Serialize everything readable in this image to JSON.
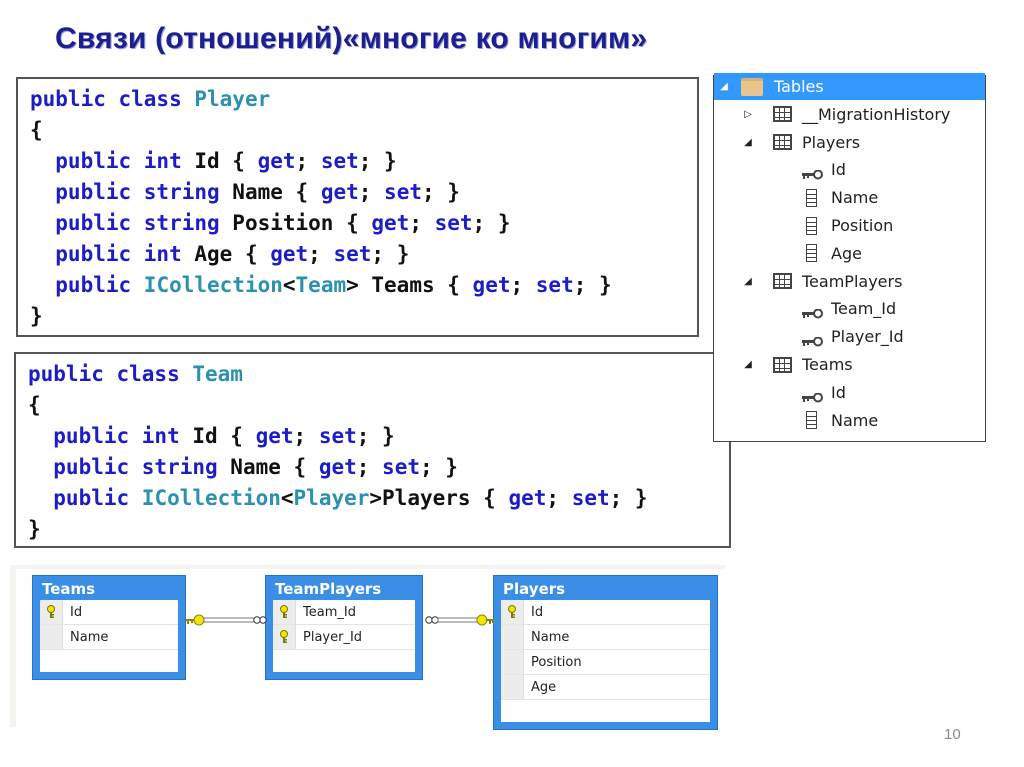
{
  "slide": {
    "title": "Связи (отношений)«многие ко многим»",
    "page_number": "10"
  },
  "code": {
    "player": {
      "lines": [
        [
          {
            "t": "public class ",
            "c": "kw"
          },
          {
            "t": "Player",
            "c": "ty"
          }
        ],
        [
          {
            "t": "{",
            "c": "pl"
          }
        ],
        [
          {
            "t": "  public int ",
            "c": "kw"
          },
          {
            "t": "Id { ",
            "c": "pl"
          },
          {
            "t": "get",
            "c": "kw"
          },
          {
            "t": "; ",
            "c": "pl"
          },
          {
            "t": "set",
            "c": "kw"
          },
          {
            "t": "; }",
            "c": "pl"
          }
        ],
        [
          {
            "t": "  public string ",
            "c": "kw"
          },
          {
            "t": "Name { ",
            "c": "pl"
          },
          {
            "t": "get",
            "c": "kw"
          },
          {
            "t": "; ",
            "c": "pl"
          },
          {
            "t": "set",
            "c": "kw"
          },
          {
            "t": "; }",
            "c": "pl"
          }
        ],
        [
          {
            "t": "  public string ",
            "c": "kw"
          },
          {
            "t": "Position { ",
            "c": "pl"
          },
          {
            "t": "get",
            "c": "kw"
          },
          {
            "t": "; ",
            "c": "pl"
          },
          {
            "t": "set",
            "c": "kw"
          },
          {
            "t": "; }",
            "c": "pl"
          }
        ],
        [
          {
            "t": "  public int ",
            "c": "kw"
          },
          {
            "t": "Age { ",
            "c": "pl"
          },
          {
            "t": "get",
            "c": "kw"
          },
          {
            "t": "; ",
            "c": "pl"
          },
          {
            "t": "set",
            "c": "kw"
          },
          {
            "t": "; }",
            "c": "pl"
          }
        ],
        [
          {
            "t": "  public ",
            "c": "kw"
          },
          {
            "t": "ICollection",
            "c": "ty"
          },
          {
            "t": "<",
            "c": "pl"
          },
          {
            "t": "Team",
            "c": "ty"
          },
          {
            "t": "> Teams { ",
            "c": "pl"
          },
          {
            "t": "get",
            "c": "kw"
          },
          {
            "t": "; ",
            "c": "pl"
          },
          {
            "t": "set",
            "c": "kw"
          },
          {
            "t": "; }",
            "c": "pl"
          }
        ],
        [
          {
            "t": "}",
            "c": "pl"
          }
        ]
      ]
    },
    "team": {
      "lines": [
        [
          {
            "t": "public class ",
            "c": "kw"
          },
          {
            "t": "Team",
            "c": "ty"
          }
        ],
        [
          {
            "t": "{",
            "c": "pl"
          }
        ],
        [
          {
            "t": "  public int ",
            "c": "kw"
          },
          {
            "t": "Id { ",
            "c": "pl"
          },
          {
            "t": "get",
            "c": "kw"
          },
          {
            "t": "; ",
            "c": "pl"
          },
          {
            "t": "set",
            "c": "kw"
          },
          {
            "t": "; }",
            "c": "pl"
          }
        ],
        [
          {
            "t": "  public string ",
            "c": "kw"
          },
          {
            "t": "Name { ",
            "c": "pl"
          },
          {
            "t": "get",
            "c": "kw"
          },
          {
            "t": "; ",
            "c": "pl"
          },
          {
            "t": "set",
            "c": "kw"
          },
          {
            "t": "; }",
            "c": "pl"
          }
        ],
        [
          {
            "t": "  public ",
            "c": "kw"
          },
          {
            "t": "ICollection",
            "c": "ty"
          },
          {
            "t": "<",
            "c": "pl"
          },
          {
            "t": "Player",
            "c": "ty"
          },
          {
            "t": ">Players { ",
            "c": "pl"
          },
          {
            "t": "get",
            "c": "kw"
          },
          {
            "t": "; ",
            "c": "pl"
          },
          {
            "t": "set",
            "c": "kw"
          },
          {
            "t": "; }",
            "c": "pl"
          }
        ],
        [
          {
            "t": "}",
            "c": "pl"
          }
        ]
      ]
    }
  },
  "explorer": {
    "items": [
      {
        "label": "Tables",
        "icon": "folder-icon",
        "expander": "expanded",
        "level": 0,
        "selected": true
      },
      {
        "label": "__MigrationHistory",
        "icon": "table-icon",
        "expander": "collapsed",
        "level": 1
      },
      {
        "label": "Players",
        "icon": "table-icon",
        "expander": "expanded",
        "level": 1
      },
      {
        "label": "Id",
        "icon": "key-icon",
        "level": 2
      },
      {
        "label": "Name",
        "icon": "column-icon",
        "level": 2
      },
      {
        "label": "Position",
        "icon": "column-icon",
        "level": 2
      },
      {
        "label": "Age",
        "icon": "column-icon",
        "level": 2
      },
      {
        "label": "TeamPlayers",
        "icon": "table-icon",
        "expander": "expanded",
        "level": 1
      },
      {
        "label": "Team_Id",
        "icon": "key-icon",
        "level": 2
      },
      {
        "label": "Player_Id",
        "icon": "key-icon",
        "level": 2
      },
      {
        "label": "Teams",
        "icon": "table-icon",
        "expander": "expanded",
        "level": 1
      },
      {
        "label": "Id",
        "icon": "key-icon",
        "level": 2
      },
      {
        "label": "Name",
        "icon": "column-icon",
        "level": 2
      }
    ]
  },
  "diagram": {
    "entities": [
      {
        "name": "Teams",
        "columns": [
          {
            "label": "Id",
            "key": true
          },
          {
            "label": "Name",
            "key": false
          }
        ]
      },
      {
        "name": "TeamPlayers",
        "columns": [
          {
            "label": "Team_Id",
            "key": true
          },
          {
            "label": "Player_Id",
            "key": true
          }
        ]
      },
      {
        "name": "Players",
        "columns": [
          {
            "label": "Id",
            "key": true
          },
          {
            "label": "Name",
            "key": false
          },
          {
            "label": "Position",
            "key": false
          },
          {
            "label": "Age",
            "key": false
          }
        ]
      }
    ],
    "relationships": [
      {
        "from": "Teams",
        "to": "TeamPlayers",
        "from_end": "one (key)",
        "to_end": "many (infinity)"
      },
      {
        "from": "TeamPlayers",
        "to": "Players",
        "from_end": "many (infinity)",
        "to_end": "one (key)"
      }
    ]
  },
  "colors": {
    "title": "#1b1f8f",
    "keyword": "#1d1dc8",
    "type": "#2b91af",
    "entity_header": "#3a8ee6",
    "selection": "#3399ff"
  }
}
